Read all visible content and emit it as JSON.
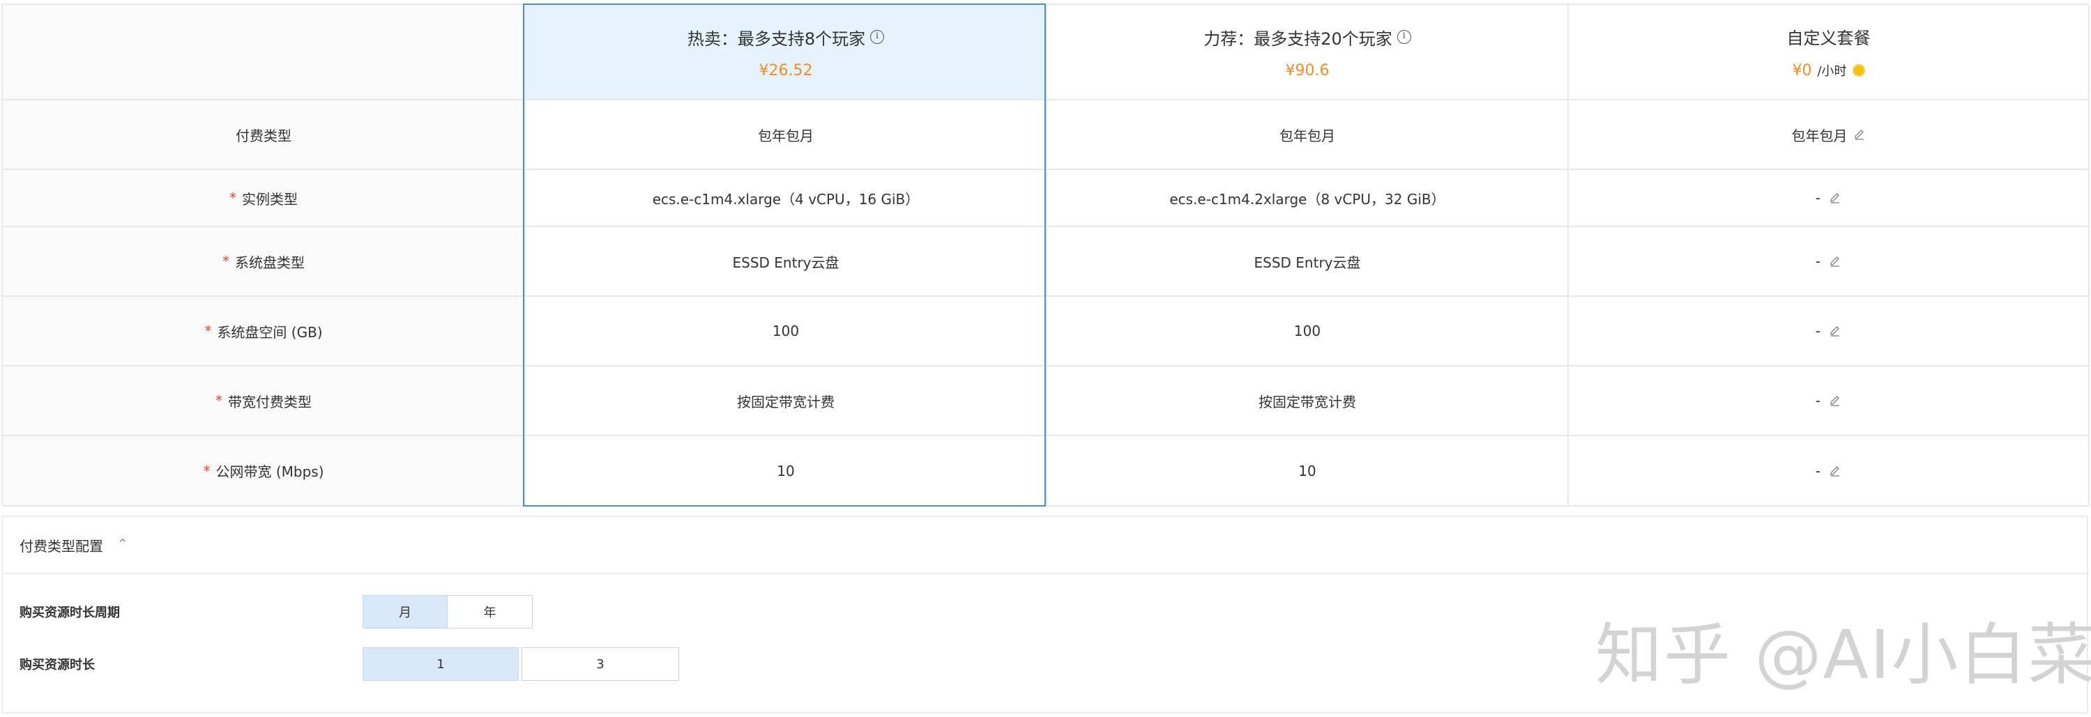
{
  "plans": [
    {
      "title": "热卖：最多支持8个玩家",
      "price": "¥26.52",
      "selected": true
    },
    {
      "title": "力荐：最多支持20个玩家",
      "price": "¥90.6",
      "selected": false
    },
    {
      "title": "自定义套餐",
      "price": "¥0",
      "unit": "/小时",
      "selected": false
    }
  ],
  "rows": [
    {
      "label": "付费类型",
      "required": false,
      "values": [
        "包年包月",
        "包年包月",
        "包年包月"
      ]
    },
    {
      "label": "实例类型",
      "required": true,
      "values": [
        "ecs.e-c1m4.xlarge（4 vCPU，16 GiB）",
        "ecs.e-c1m4.2xlarge（8 vCPU，32 GiB）",
        "-"
      ]
    },
    {
      "label": "系统盘类型",
      "required": true,
      "values": [
        "ESSD Entry云盘",
        "ESSD Entry云盘",
        "-"
      ]
    },
    {
      "label": "系统盘空间 (GB)",
      "required": true,
      "values": [
        "100",
        "100",
        "-"
      ]
    },
    {
      "label": "带宽付费类型",
      "required": true,
      "values": [
        "按固定带宽计费",
        "按固定带宽计费",
        "-"
      ]
    },
    {
      "label": "公网带宽 (Mbps)",
      "required": true,
      "values": [
        "10",
        "10",
        "-"
      ]
    }
  ],
  "required_mark": "*",
  "payment": {
    "title": "付费类型配置",
    "period": {
      "label": "购买资源时长周期",
      "options": [
        "月",
        "年"
      ],
      "selected": "月"
    },
    "duration": {
      "label": "购买资源时长",
      "options": [
        "1",
        "3"
      ],
      "selected": "1"
    }
  },
  "watermark": "知乎 @AI小白菜",
  "colors": {
    "accent_price": "#f28c2a",
    "selected_bg": "#e5f3fe",
    "selected_border": "#4a90c8",
    "required": "#e0483b",
    "active_option_bg": "#d8e8f8"
  }
}
